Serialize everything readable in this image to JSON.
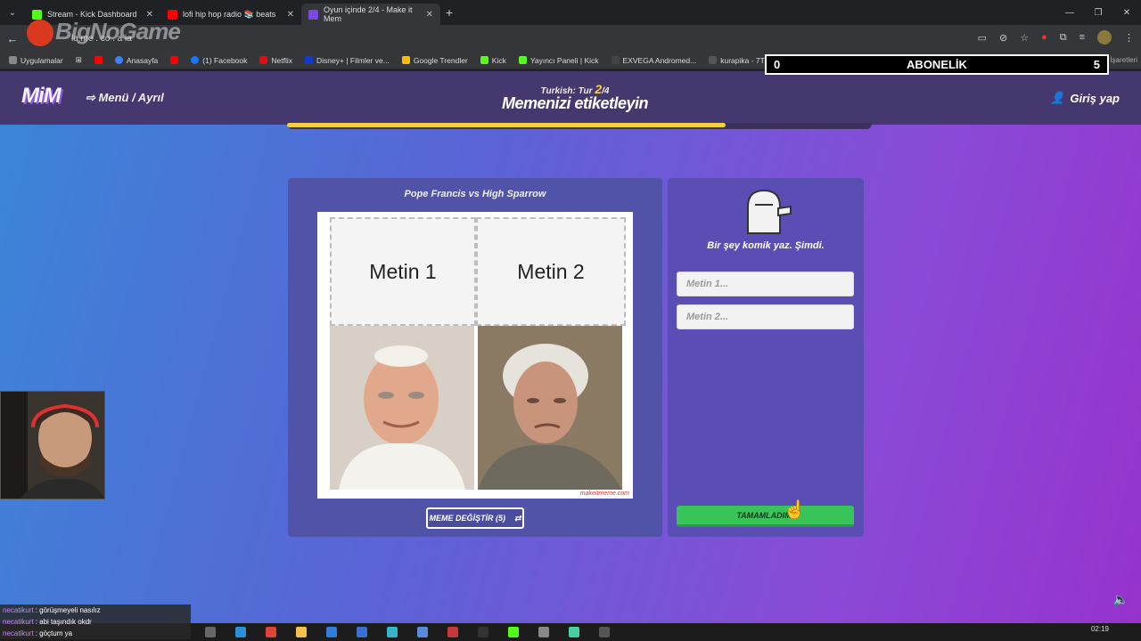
{
  "browser": {
    "tabs": [
      {
        "label": "Stream - Kick Dashboard",
        "color": "#53fc18"
      },
      {
        "label": "lofi hip hop radio 📚 beats",
        "color": "#ff0000"
      },
      {
        "label": "Oyun içinde 2/4 - Make it Mem",
        "color": "#7a4ae0"
      }
    ],
    "url": "la      me  . co  . a   ia",
    "overlay_logo": "BigNoGame",
    "bookmarks": [
      {
        "label": "Uygulamalar",
        "color": "#888"
      },
      {
        "label": "",
        "color": "#ff0000"
      },
      {
        "label": "Anasayfa",
        "color": "#3b82f6"
      },
      {
        "label": "",
        "color": "#ff0000"
      },
      {
        "label": "(1) Facebook",
        "color": "#1877f2"
      },
      {
        "label": "Netflix",
        "color": "#e50914"
      },
      {
        "label": "Disney+ | Filmler ve...",
        "color": "#113ccf"
      },
      {
        "label": "Google Trendler",
        "color": "#fbbc05"
      },
      {
        "label": "Kick",
        "color": "#53fc18"
      },
      {
        "label": "Yayıncı Paneli | Kick",
        "color": "#53fc18"
      },
      {
        "label": "EXVEGA Andromed...",
        "color": "#444"
      },
      {
        "label": "kurapika - 7TV",
        "color": "#555"
      }
    ],
    "bookmarks_right": "Tüm Yer İşaretleri"
  },
  "abonelik": {
    "left": "0",
    "label": "ABONELİK",
    "right": "5"
  },
  "game": {
    "brand": "MiM",
    "menu": "Menü / Ayrıl",
    "round_prefix": "Turkish: Tur",
    "round_current": "2",
    "round_total": "/4",
    "phase_title": "Memenizi etiketleyin",
    "login": "Giriş yap",
    "progress": 0.75,
    "meme_title": "Pope Francis vs High Sparrow",
    "meme_text1": "Metin 1",
    "meme_text2": "Metin 2",
    "watermark": "makeitmeme.com",
    "change_button": "MEME DEĞİŞTİR (5)",
    "prompt": "Bir şey komik yaz. Şimdi.",
    "input1_placeholder": "Metin 1...",
    "input2_placeholder": "Metin 2...",
    "done_button": "TAMAMLADIM!"
  },
  "chat": [
    {
      "user": "necatikurt",
      "msg": ": görüşmeyeli nasılız"
    },
    {
      "user": "necatikurt",
      "msg": ": abi taşındık okdr"
    },
    {
      "user": "necatikurt",
      "msg": ": göçtum ya"
    }
  ],
  "clock": "02:19"
}
